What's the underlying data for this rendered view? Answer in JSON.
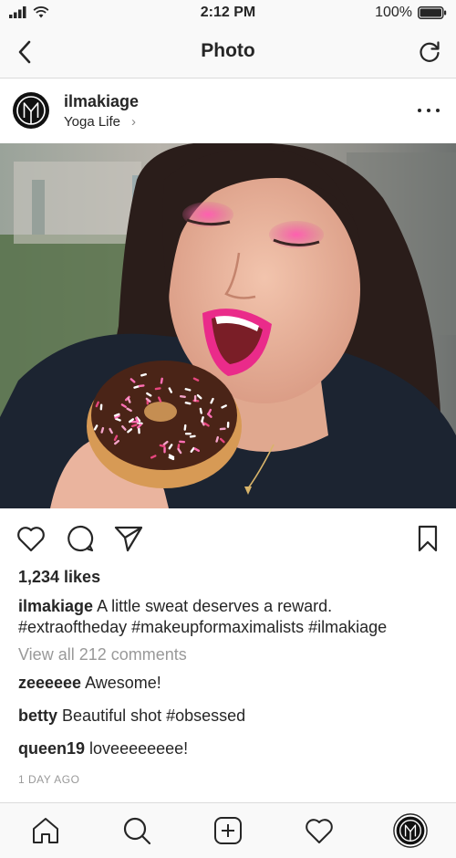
{
  "status_bar": {
    "time": "2:12 PM",
    "battery_percent": "100%",
    "battery_level": 1.0
  },
  "nav": {
    "title": "Photo",
    "back_icon": "chevron-left-icon",
    "refresh_icon": "refresh-icon"
  },
  "post": {
    "username": "ilmakiage",
    "location": "Yoga Life",
    "likes": "1,234 likes",
    "caption": {
      "username": "ilmakiage",
      "text": "A little sweat deserves a reward. #extraoftheday #makeupformaximalists #ilmakiage"
    },
    "view_all_comments": "View all 212 comments",
    "comments": [
      {
        "username": "zeeeeee",
        "text": "Awesome!"
      },
      {
        "username": "betty",
        "text": "Beautiful shot #obsessed"
      },
      {
        "username": "queen19",
        "text": "loveeeeeeee!"
      }
    ],
    "timestamp": "1 DAY AGO"
  },
  "tab_bar": {
    "items": [
      "home-icon",
      "search-icon",
      "add-icon",
      "heart-icon",
      "profile-icon"
    ]
  }
}
